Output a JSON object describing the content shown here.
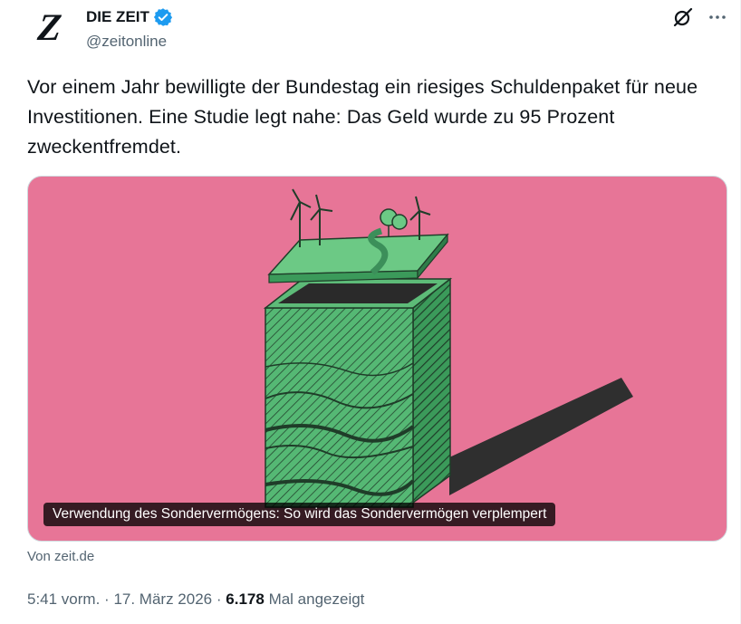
{
  "author": {
    "display_name": "DIE ZEIT",
    "handle": "@zeitonline",
    "avatar_letter": "Z",
    "verified": true
  },
  "tweet": {
    "text": "Vor einem Jahr bewilligte der Bundestag ein riesiges Schuldenpaket für neue Investitionen. Eine Studie legt nahe: Das Geld wurde zu 95 Prozent zweckentfremdet."
  },
  "card": {
    "caption": "Verwendung des Sondervermögens: So wird das Sondervermögen verplempert",
    "source": "Von zeit.de",
    "background_color": "#e77597"
  },
  "meta": {
    "time": "5:41 vorm.",
    "separator1": "·",
    "date": "17. März 2026",
    "separator2": "·",
    "views": "6.178",
    "views_label": "Mal angezeigt"
  },
  "icons": {
    "verified": "verified-badge-icon",
    "grok": "grok-icon",
    "more": "more-icon"
  },
  "colors": {
    "text": "#0f1419",
    "secondary": "#536471",
    "verified": "#1d9bf0"
  }
}
